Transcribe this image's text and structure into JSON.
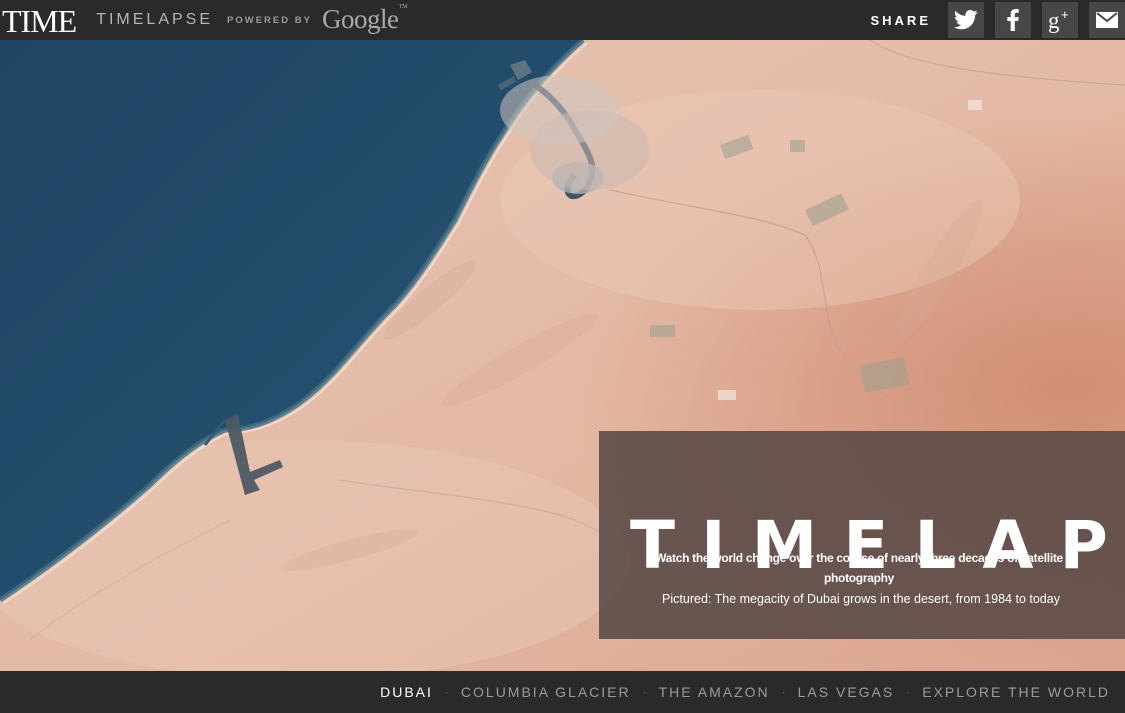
{
  "header": {
    "brand": "TIME",
    "product": "TIMELAPSE",
    "powered_by": "POWERED BY",
    "partner": "Google",
    "share_label": "SHARE",
    "share_buttons": [
      {
        "icon": "twitter-icon",
        "label": "Twitter"
      },
      {
        "icon": "facebook-icon",
        "label": "Facebook"
      },
      {
        "icon": "google-plus-icon",
        "label": "Google+"
      },
      {
        "icon": "email-icon",
        "label": "Email"
      }
    ]
  },
  "intro": {
    "title": "TIMELAPSE",
    "tagline": "Watch the world change over the course of nearly three decades of satellite photography",
    "caption": "Pictured: The megacity of Dubai grows in the desert, from 1984 to today"
  },
  "nav": {
    "items": [
      {
        "label": "DUBAI",
        "active": true
      },
      {
        "label": "COLUMBIA GLACIER",
        "active": false
      },
      {
        "label": "THE AMAZON",
        "active": false
      },
      {
        "label": "LAS VEGAS",
        "active": false
      },
      {
        "label": "EXPLORE THE WORLD",
        "active": false
      }
    ],
    "separator": "·"
  },
  "colors": {
    "bar_background": "#2a2a2a",
    "share_button": "#474747",
    "sea": "#234a68",
    "desert": "#e3b8a4",
    "overlay": "#554644"
  }
}
